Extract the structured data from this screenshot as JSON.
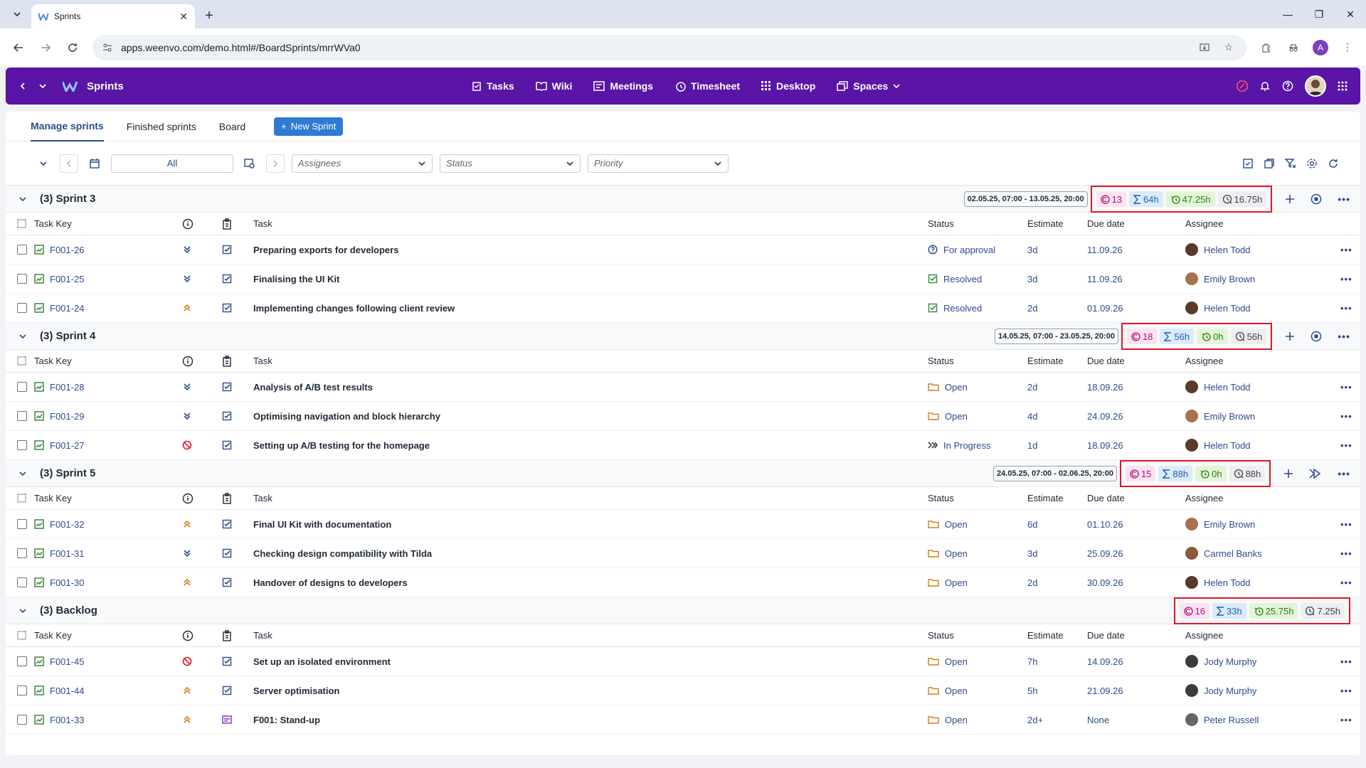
{
  "browser": {
    "tab_title": "Sprints",
    "url": "apps.weenvo.com/demo.html#/BoardSprints/mrrWVa0",
    "profile_initial": "A"
  },
  "header": {
    "brand": "Sprints",
    "nav": [
      {
        "label": "Tasks",
        "icon": "clipboard-icon"
      },
      {
        "label": "Wiki",
        "icon": "book-icon"
      },
      {
        "label": "Meetings",
        "icon": "meetings-icon"
      },
      {
        "label": "Timesheet",
        "icon": "timesheet-icon"
      },
      {
        "label": "Desktop",
        "icon": "grid-icon"
      },
      {
        "label": "Spaces",
        "icon": "spaces-icon"
      }
    ]
  },
  "subtabs": {
    "manage": "Manage sprints",
    "finished": "Finished sprints",
    "board": "Board",
    "new_sprint": "New Sprint"
  },
  "filters": {
    "range": "All",
    "assignees": "Assignees",
    "status": "Status",
    "priority": "Priority"
  },
  "columns": {
    "key": "Task Key",
    "task": "Task",
    "status": "Status",
    "estimate": "Estimate",
    "due": "Due date",
    "assignee": "Assignee"
  },
  "sprints": [
    {
      "title": "(3) Sprint 3",
      "dates": "02.05.25, 07:00 - 13.05.25, 20:00",
      "stats": {
        "count": "13",
        "sum": "64h",
        "spent": "47.25h",
        "remaining": "16.75h"
      },
      "action": "stop",
      "rows": [
        {
          "key": "F001-26",
          "priority": "low",
          "type": "task",
          "task": "Preparing exports for developers",
          "status": "For approval",
          "status_icon": "question",
          "estimate": "3d",
          "due": "11.09.26",
          "assignee": "Helen Todd"
        },
        {
          "key": "F001-25",
          "priority": "low",
          "type": "task",
          "task": "Finalising the UI Kit",
          "status": "Resolved",
          "status_icon": "resolved",
          "estimate": "3d",
          "due": "11.09.26",
          "assignee": "Emily Brown"
        },
        {
          "key": "F001-24",
          "priority": "high",
          "type": "task",
          "task": "Implementing changes following client review",
          "status": "Resolved",
          "status_icon": "resolved",
          "estimate": "2d",
          "due": "01.09.26",
          "assignee": "Helen Todd"
        }
      ]
    },
    {
      "title": "(3) Sprint 4",
      "dates": "14.05.25, 07:00 - 23.05.25, 20:00",
      "stats": {
        "count": "18",
        "sum": "56h",
        "spent": "0h",
        "remaining": "56h"
      },
      "action": "stop",
      "rows": [
        {
          "key": "F001-28",
          "priority": "low",
          "type": "task",
          "task": "Analysis of A/B test results",
          "status": "Open",
          "status_icon": "folder",
          "estimate": "2d",
          "due": "18.09.26",
          "assignee": "Helen Todd"
        },
        {
          "key": "F001-29",
          "priority": "low",
          "type": "task",
          "task": "Optimising navigation and block hierarchy",
          "status": "Open",
          "status_icon": "folder",
          "estimate": "4d",
          "due": "24.09.26",
          "assignee": "Emily Brown"
        },
        {
          "key": "F001-27",
          "priority": "blocker",
          "type": "task",
          "task": "Setting up A/B testing for the homepage",
          "status": "In Progress",
          "status_icon": "progress",
          "estimate": "1d",
          "due": "18.09.26",
          "assignee": "Helen Todd"
        }
      ]
    },
    {
      "title": "(3) Sprint 5",
      "dates": "24.05.25, 07:00 - 02.06.25, 20:00",
      "stats": {
        "count": "15",
        "sum": "88h",
        "spent": "0h",
        "remaining": "88h"
      },
      "action": "start",
      "rows": [
        {
          "key": "F001-32",
          "priority": "high",
          "type": "task",
          "task": "Final UI Kit with documentation",
          "status": "Open",
          "status_icon": "folder",
          "estimate": "6d",
          "due": "01.10.26",
          "assignee": "Emily Brown"
        },
        {
          "key": "F001-31",
          "priority": "low",
          "type": "task",
          "task": "Checking design compatibility with Tilda",
          "status": "Open",
          "status_icon": "folder",
          "estimate": "3d",
          "due": "25.09.26",
          "assignee": "Carmel Banks"
        },
        {
          "key": "F001-30",
          "priority": "high",
          "type": "task",
          "task": "Handover of designs to developers",
          "status": "Open",
          "status_icon": "folder",
          "estimate": "2d",
          "due": "30.09.26",
          "assignee": "Helen Todd"
        }
      ]
    },
    {
      "title": "(3) Backlog",
      "dates": "",
      "stats": {
        "count": "16",
        "sum": "33h",
        "spent": "25.75h",
        "remaining": "7.25h"
      },
      "action": "none",
      "rows": [
        {
          "key": "F001-45",
          "priority": "blocker",
          "type": "task",
          "task": "Set up an isolated environment",
          "status": "Open",
          "status_icon": "folder",
          "estimate": "7h",
          "due": "14.09.26",
          "assignee": "Jody Murphy"
        },
        {
          "key": "F001-44",
          "priority": "high",
          "type": "task",
          "task": "Server optimisation",
          "status": "Open",
          "status_icon": "folder",
          "estimate": "5h",
          "due": "21.09.26",
          "assignee": "Jody Murphy"
        },
        {
          "key": "F001-33",
          "priority": "high",
          "type": "meeting",
          "task": "F001: Stand-up",
          "status": "Open",
          "status_icon": "folder",
          "estimate": "2d+",
          "due": "None",
          "assignee": "Peter Russell"
        }
      ]
    }
  ]
}
